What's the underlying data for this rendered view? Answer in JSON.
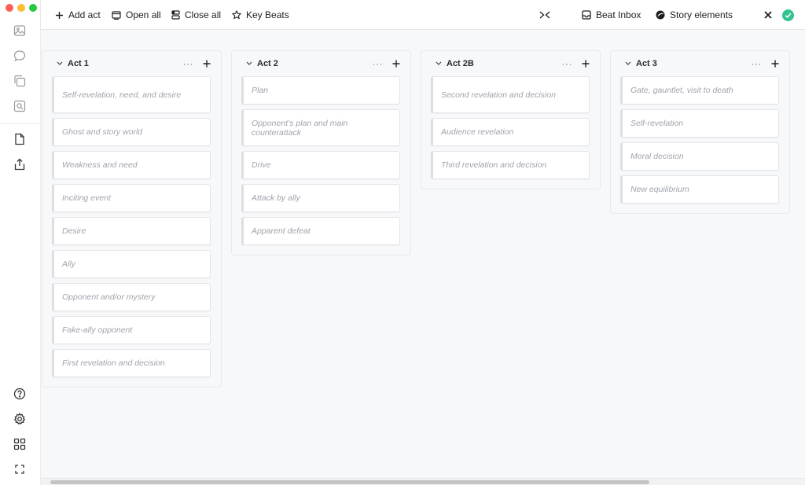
{
  "toolbar": {
    "add_act": "Add act",
    "open_all": "Open all",
    "close_all": "Close all",
    "key_beats": "Key Beats",
    "beat_inbox": "Beat Inbox",
    "story_elements": "Story elements"
  },
  "acts": [
    {
      "title": "Act 1",
      "beats": [
        "Self-revelation, need, and desire",
        "Ghost and story world",
        "Weakness and need",
        "Inciting event",
        "Desire",
        "Ally",
        "Opponent and/or mystery",
        "Fake-ally opponent",
        "First revelation and decision"
      ]
    },
    {
      "title": "Act 2",
      "beats": [
        "Plan",
        "Opponent’s plan and main counterattack",
        "Drive",
        "Attack by ally",
        "Apparent defeat"
      ]
    },
    {
      "title": "Act 2B",
      "beats": [
        "Second revelation and decision",
        "Audience revelation",
        "Third revelation and decision"
      ]
    },
    {
      "title": "Act 3",
      "beats": [
        "Gate, gauntlet, visit to death",
        "Self-revelation",
        "Moral decision",
        "New equilibrium"
      ]
    }
  ],
  "colors": {
    "accent_green": "#34c38f",
    "window_red": "#ff5f57",
    "window_yellow": "#febc2e",
    "window_green": "#28c840"
  }
}
